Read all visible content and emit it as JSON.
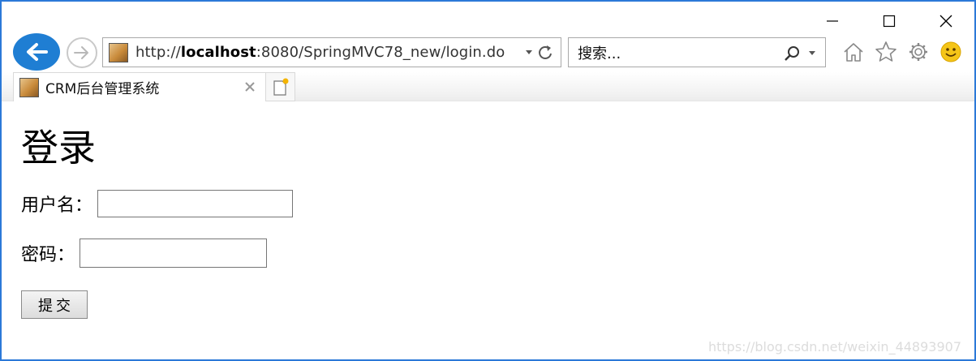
{
  "window": {
    "controls": [
      "minimize",
      "maximize",
      "close"
    ]
  },
  "nav": {
    "back_icon": "back-arrow-icon",
    "forward_icon": "forward-arrow-icon",
    "address": {
      "prefix": "http://",
      "host": "localhost",
      "rest": ":8080/SpringMVC78_new/login.do"
    },
    "search": {
      "placeholder": "搜索..."
    },
    "tools": [
      "home-icon",
      "favorites-star-icon",
      "settings-gear-icon",
      "feedback-smiley-icon"
    ]
  },
  "tab": {
    "title": "CRM后台管理系统"
  },
  "page": {
    "heading": "登录",
    "username_label": "用户名：",
    "username_value": "",
    "password_label": "密码：",
    "password_value": "",
    "submit_label": "提交"
  },
  "watermark": "https://blog.csdn.net/weixin_44893907",
  "colors": {
    "accent": "#1f7ed3",
    "window_border": "#2b79d8"
  }
}
